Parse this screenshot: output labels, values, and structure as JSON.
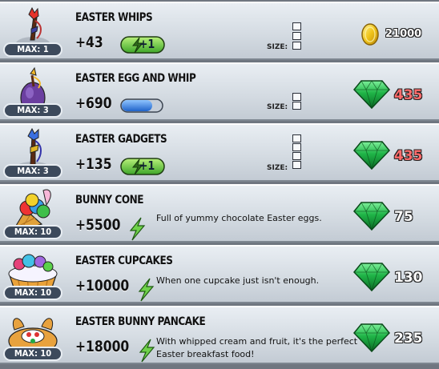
{
  "items": [
    {
      "name": "EASTER WHIPS",
      "power": "+43",
      "badge": "+1",
      "max": "MAX: 1",
      "description": "",
      "price": "21000",
      "currency": "coin",
      "size_cells": 3
    },
    {
      "name": "EASTER EGG AND WHIP",
      "power": "+690",
      "badge": "",
      "max": "MAX: 3",
      "description": "",
      "price": "435",
      "currency": "gem",
      "size_cells": 2
    },
    {
      "name": "EASTER GADGETS",
      "power": "+135",
      "badge": "+1",
      "max": "MAX: 3",
      "description": "",
      "price": "435",
      "currency": "gem",
      "size_cells": 4
    },
    {
      "name": "BUNNY CONE",
      "power": "+5500",
      "badge": "",
      "max": "MAX: 10",
      "description": "Full of yummy chocolate Easter eggs.",
      "price": "75",
      "currency": "gem",
      "size_cells": 0
    },
    {
      "name": "EASTER CUPCAKES",
      "power": "+10000",
      "badge": "",
      "max": "MAX: 10",
      "description": "When one cupcake just isn't enough.",
      "price": "130",
      "currency": "gem",
      "size_cells": 0
    },
    {
      "name": "EASTER BUNNY PANCAKE",
      "power": "+18000",
      "badge": "",
      "max": "MAX: 10",
      "description_line1": "With whipped cream and fruit, it's the perfect",
      "description_line2": "Easter breakfast food!",
      "price": "235",
      "currency": "gem",
      "size_cells": 0
    }
  ],
  "size_label": "SIZE:",
  "colors": {
    "gem": "#22b84a",
    "coin": "#f2c21a",
    "energy": "#6fd14a",
    "price_red": "#ff6b6b"
  },
  "icons": [
    "whip-icon",
    "egg-whip-icon",
    "gadget-icon",
    "bunny-cone-icon",
    "cupcakes-icon",
    "pancake-icon",
    "gem-icon",
    "coin-icon",
    "energy-bolt-icon"
  ]
}
